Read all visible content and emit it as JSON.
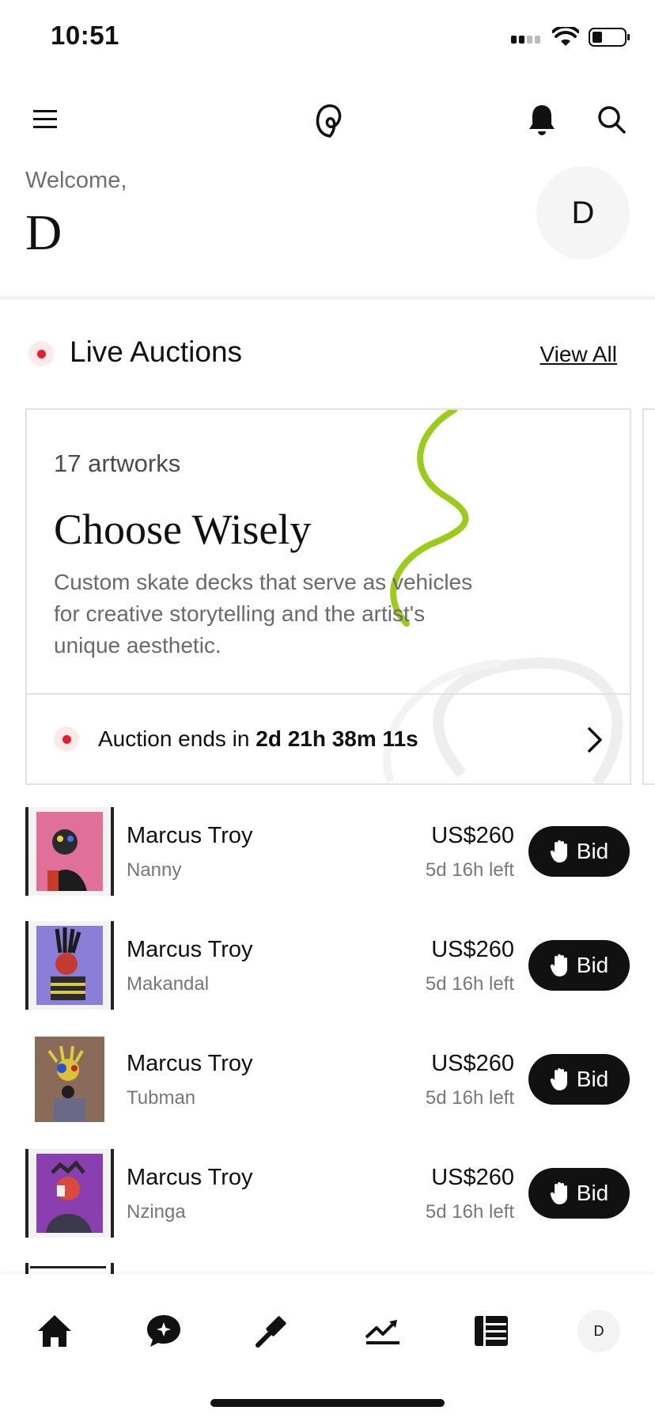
{
  "status_bar": {
    "time": "10:51"
  },
  "header": {
    "logo_icon": "artsy-logo-icon"
  },
  "welcome": {
    "greeting": "Welcome,",
    "name": "D",
    "avatar_initial": "D"
  },
  "live_auctions": {
    "title": "Live Auctions",
    "view_all": "View All",
    "card": {
      "count": "17 artworks",
      "title": "Choose Wisely",
      "description": "Custom skate decks that serve as vehicles for creative storytelling and the artist's unique aesthetic.",
      "ends_prefix": "Auction ends in ",
      "ends_value": "2d 21h 38m 11s"
    }
  },
  "lots": [
    {
      "artist": "Marcus Troy",
      "title": "Nanny",
      "price": "US$260",
      "time_left": "5d 16h left",
      "bid_label": "Bid"
    },
    {
      "artist": "Marcus Troy",
      "title": "Makandal",
      "price": "US$260",
      "time_left": "5d 16h left",
      "bid_label": "Bid"
    },
    {
      "artist": "Marcus Troy",
      "title": "Tubman",
      "price": "US$260",
      "time_left": "5d 16h left",
      "bid_label": "Bid"
    },
    {
      "artist": "Marcus Troy",
      "title": "Nzinga",
      "price": "US$260",
      "time_left": "5d 16h left",
      "bid_label": "Bid"
    }
  ],
  "tabbar": {
    "items": [
      "home-icon",
      "chat-icon",
      "auction-gavel-icon",
      "trending-icon",
      "list-icon"
    ],
    "avatar_initial": "D"
  },
  "colors": {
    "live_red": "#e0202f",
    "accent_green": "#9ccc1b",
    "button_black": "#111111"
  }
}
